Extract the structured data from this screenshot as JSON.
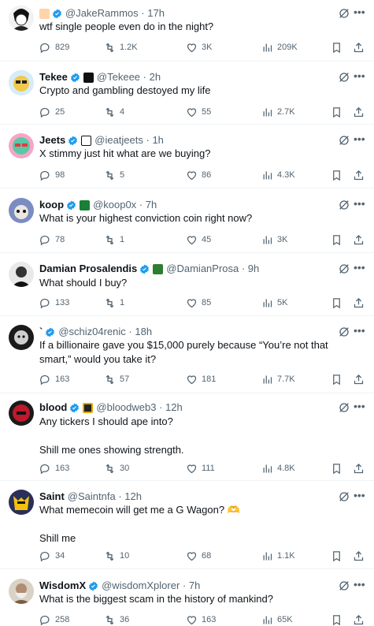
{
  "colors": {
    "accent": "#1d9bf0",
    "muted": "#536471",
    "text": "#0f1419",
    "divider": "#eff3f4"
  },
  "posts": [
    {
      "name": "",
      "handle": "@JakeRammos",
      "time": "17h",
      "text": "wtf single people even do in the night?",
      "replies": "829",
      "reposts": "1.2K",
      "likes": "3K",
      "views": "209K"
    },
    {
      "name": "Tekee",
      "handle": "@Tekeee",
      "time": "2h",
      "text": "Crypto and gambling destoyed my life",
      "replies": "25",
      "reposts": "4",
      "likes": "55",
      "views": "2.7K"
    },
    {
      "name": "Jeets",
      "handle": "@ieatjeets",
      "time": "1h",
      "text": "X stimmy just hit what are we buying?",
      "replies": "98",
      "reposts": "5",
      "likes": "86",
      "views": "4.3K"
    },
    {
      "name": "koop",
      "handle": "@koop0x",
      "time": "7h",
      "text": "What is your highest conviction coin right now?",
      "replies": "78",
      "reposts": "1",
      "likes": "45",
      "views": "3K"
    },
    {
      "name": "Damian Prosalendis",
      "handle": "@DamianProsa",
      "time": "9h",
      "text": "What should I buy?",
      "replies": "133",
      "reposts": "1",
      "likes": "85",
      "views": "5K"
    },
    {
      "name": "`",
      "handle": "@schiz04renic",
      "time": "18h",
      "text": "If a billionaire gave you $15,000 purely because “You’re not that smart,” would you take it?",
      "replies": "163",
      "reposts": "57",
      "likes": "181",
      "views": "7.7K"
    },
    {
      "name": "blood",
      "handle": "@bloodweb3",
      "time": "12h",
      "text": "Any tickers I should ape into?\n\nShill me ones showing strength.",
      "replies": "163",
      "reposts": "30",
      "likes": "111",
      "views": "4.8K"
    },
    {
      "name": "Saint",
      "handle": "@Saintnfa",
      "time": "12h",
      "text": "What memecoin will get me a G Wagon? 🫶\n\nShill me",
      "replies": "34",
      "reposts": "10",
      "likes": "68",
      "views": "1.1K"
    },
    {
      "name": "WisdomX",
      "handle": "@wisdomXplorer",
      "time": "7h",
      "text": "What is the biggest scam in the history of mankind?",
      "replies": "258",
      "reposts": "36",
      "likes": "163",
      "views": "65K"
    }
  ],
  "icons": {
    "reply": "reply-icon",
    "repost": "repost-icon",
    "like": "heart-icon",
    "views": "views-icon",
    "bookmark": "bookmark-icon",
    "share": "share-icon",
    "grok": "grok-icon",
    "more": "more-icon",
    "verified": "verified-badge-icon"
  }
}
